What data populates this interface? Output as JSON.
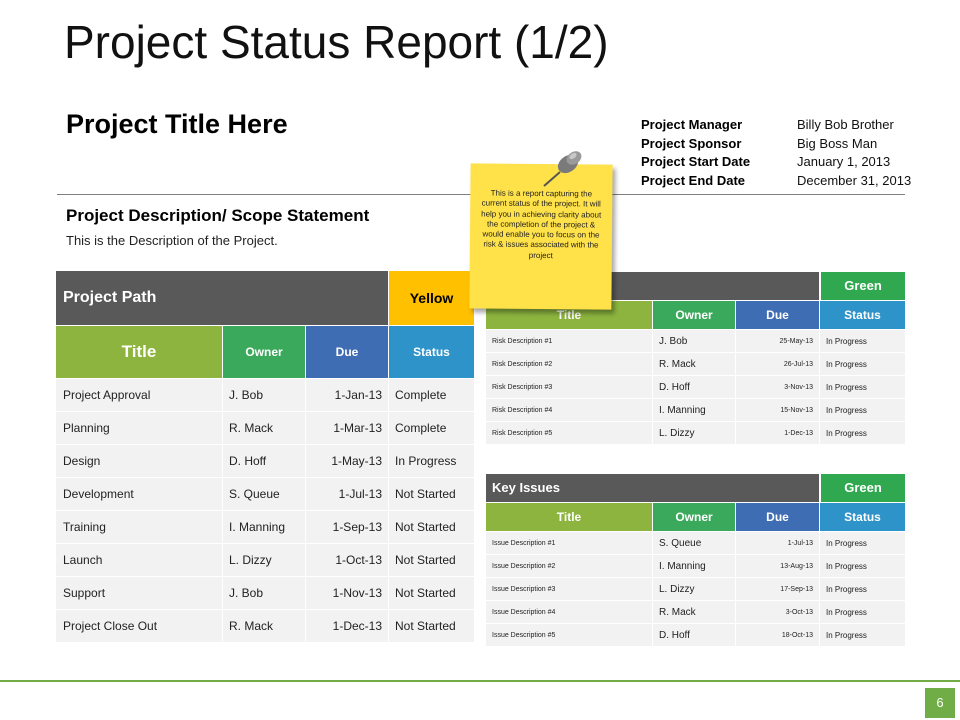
{
  "slide": {
    "title": "Project Status Report (1/2)",
    "project_title": "Project Title Here",
    "description_heading": "Project Description/ Scope Statement",
    "description_text": "This is the Description of the Project.",
    "page_number": "6"
  },
  "meta": [
    {
      "label": "Project Manager",
      "value": "Billy Bob Brother"
    },
    {
      "label": "Project Sponsor",
      "value": "Big Boss Man"
    },
    {
      "label": "Project Start Date",
      "value": "January 1, 2013"
    },
    {
      "label": "Project End Date",
      "value": "December 31, 2013"
    }
  ],
  "sticky_note": "This is a report capturing the current status of the project. It will help you in achieving clarity about the completion of the project & would enable you to focus on the risk & issues associated with the project",
  "project_path": {
    "heading": "Project Path",
    "status": "Yellow",
    "columns": [
      "Title",
      "Owner",
      "Due",
      "Status"
    ],
    "rows": [
      [
        "Project Approval",
        "J. Bob",
        "1-Jan-13",
        "Complete"
      ],
      [
        "Planning",
        "R. Mack",
        "1-Mar-13",
        "Complete"
      ],
      [
        "Design",
        "D. Hoff",
        "1-May-13",
        "In Progress"
      ],
      [
        "Development",
        "S. Queue",
        "1-Jul-13",
        "Not Started"
      ],
      [
        "Training",
        "I. Manning",
        "1-Sep-13",
        "Not Started"
      ],
      [
        "Launch",
        "L. Dizzy",
        "1-Oct-13",
        "Not Started"
      ],
      [
        "Support",
        "J. Bob",
        "1-Nov-13",
        "Not Started"
      ],
      [
        "Project Close Out",
        "R. Mack",
        "1-Dec-13",
        "Not Started"
      ]
    ]
  },
  "risks": {
    "heading": "",
    "status": "Green",
    "columns": [
      "Title",
      "Owner",
      "Due",
      "Status"
    ],
    "rows": [
      [
        "Risk Description #1",
        "J. Bob",
        "25-May-13",
        "In Progress"
      ],
      [
        "Risk Description #2",
        "R. Mack",
        "26-Jul-13",
        "In Progress"
      ],
      [
        "Risk Description #3",
        "D. Hoff",
        "3-Nov-13",
        "In Progress"
      ],
      [
        "Risk Description #4",
        "I. Manning",
        "15-Nov-13",
        "In Progress"
      ],
      [
        "Risk Description #5",
        "L. Dizzy",
        "1-Dec-13",
        "In Progress"
      ]
    ]
  },
  "issues": {
    "heading": "Key Issues",
    "status": "Green",
    "columns": [
      "Title",
      "Owner",
      "Due",
      "Status"
    ],
    "rows": [
      [
        "Issue Description #1",
        "S. Queue",
        "1-Jul-13",
        "In Progress"
      ],
      [
        "Issue Description #2",
        "I. Manning",
        "13-Aug-13",
        "In Progress"
      ],
      [
        "Issue Description #3",
        "L. Dizzy",
        "17-Sep-13",
        "In Progress"
      ],
      [
        "Issue Description #4",
        "R. Mack",
        "3-Oct-13",
        "In Progress"
      ],
      [
        "Issue Description #5",
        "D. Hoff",
        "18-Oct-13",
        "In Progress"
      ]
    ]
  },
  "colors": {
    "dark_header": "#595959",
    "yellow": "#ffc000",
    "green": "#70ad47",
    "blue": "#3f6db4",
    "teal": "#2e93c9",
    "sticky": "#ffe14a"
  },
  "icons": {
    "pin": "push-pin-icon"
  }
}
